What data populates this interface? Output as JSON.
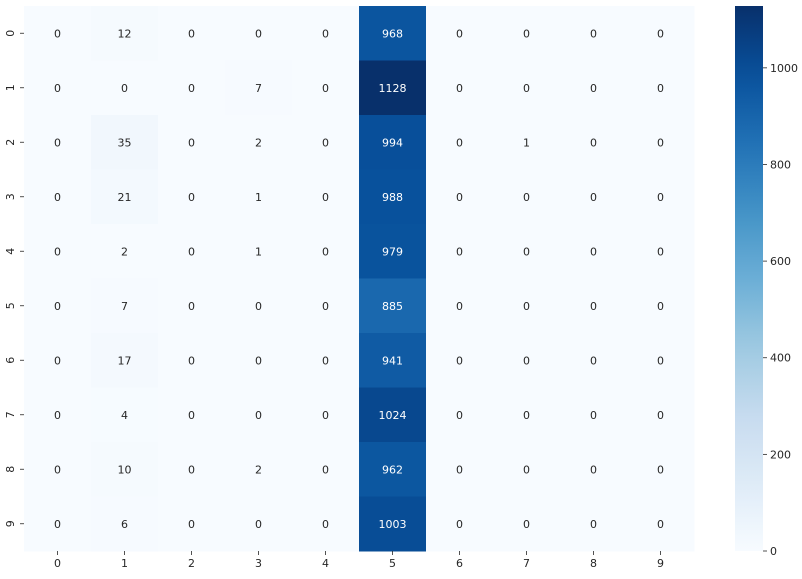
{
  "chart_data": {
    "type": "heatmap",
    "title": "",
    "xlabel": "",
    "ylabel": "",
    "x_categories": [
      "0",
      "1",
      "2",
      "3",
      "4",
      "5",
      "6",
      "7",
      "8",
      "9"
    ],
    "y_categories": [
      "0",
      "1",
      "2",
      "3",
      "4",
      "5",
      "6",
      "7",
      "8",
      "9"
    ],
    "values": [
      [
        0,
        12,
        0,
        0,
        0,
        968,
        0,
        0,
        0,
        0
      ],
      [
        0,
        0,
        0,
        7,
        0,
        1128,
        0,
        0,
        0,
        0
      ],
      [
        0,
        35,
        0,
        2,
        0,
        994,
        0,
        1,
        0,
        0
      ],
      [
        0,
        21,
        0,
        1,
        0,
        988,
        0,
        0,
        0,
        0
      ],
      [
        0,
        2,
        0,
        1,
        0,
        979,
        0,
        0,
        0,
        0
      ],
      [
        0,
        7,
        0,
        0,
        0,
        885,
        0,
        0,
        0,
        0
      ],
      [
        0,
        17,
        0,
        0,
        0,
        941,
        0,
        0,
        0,
        0
      ],
      [
        0,
        4,
        0,
        0,
        0,
        1024,
        0,
        0,
        0,
        0
      ],
      [
        0,
        10,
        0,
        2,
        0,
        962,
        0,
        0,
        0,
        0
      ],
      [
        0,
        6,
        0,
        0,
        0,
        1003,
        0,
        0,
        0,
        0
      ]
    ],
    "colormap": "Blues",
    "color_range": [
      0,
      1128
    ],
    "colorbar": {
      "position": "right",
      "ticks": [
        0,
        200,
        400,
        600,
        800,
        1000
      ]
    },
    "annotations": true,
    "grid": false,
    "colors": {
      "low": "#f7fbff",
      "high": "#08306b",
      "dark_text": "#262626",
      "light_text": "#ffffff"
    }
  }
}
